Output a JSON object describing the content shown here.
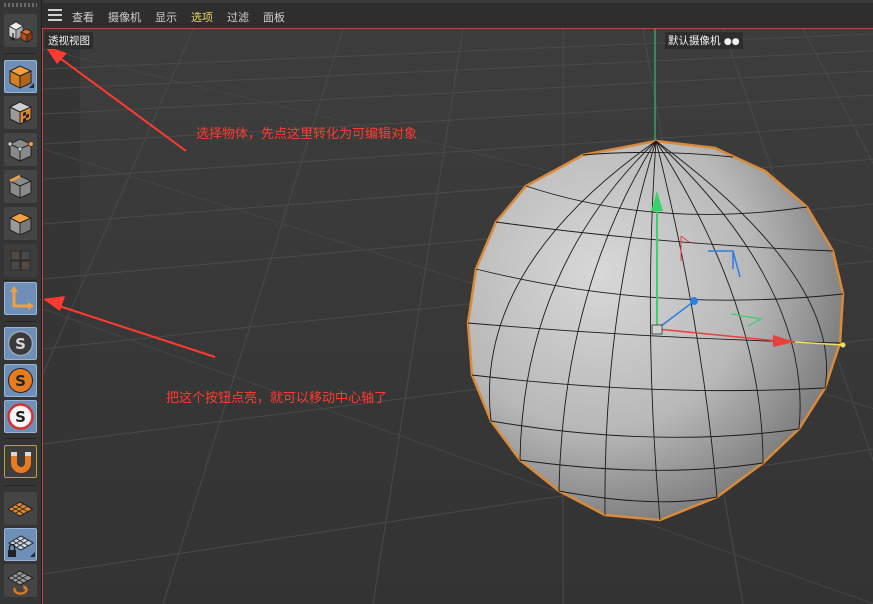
{
  "menubar": {
    "items": [
      {
        "label": "查看"
      },
      {
        "label": "摄像机"
      },
      {
        "label": "显示"
      },
      {
        "label": "选项"
      },
      {
        "label": "过滤"
      },
      {
        "label": "面板"
      }
    ]
  },
  "viewport": {
    "view_label": "透视视图",
    "camera_label": "默认摄像机"
  },
  "toolbar": {
    "buttons": [
      {
        "name": "make-editable",
        "icon": "make-editable-icon",
        "active": false
      },
      {
        "name": "model-mode",
        "icon": "model-mode-icon",
        "active": true
      },
      {
        "name": "texture-mode",
        "icon": "texture-mode-icon",
        "active": false
      },
      {
        "name": "points-mode",
        "icon": "points-mode-icon",
        "active": false
      },
      {
        "name": "edges-mode",
        "icon": "edges-mode-icon",
        "active": false
      },
      {
        "name": "polygons-mode",
        "icon": "polygons-mode-icon",
        "active": false
      },
      {
        "name": "uv-mode",
        "icon": "uv-mode-icon",
        "active": false
      },
      {
        "name": "enable-axis",
        "icon": "axis-icon",
        "active": true
      },
      {
        "name": "snap-settings",
        "icon": "snap-icon",
        "active": false
      },
      {
        "name": "snap-enable",
        "icon": "snap-orange-icon",
        "active": false
      },
      {
        "name": "snap-off",
        "icon": "snap-off-icon",
        "active": false
      },
      {
        "name": "magnet",
        "icon": "magnet-icon",
        "active": false
      },
      {
        "name": "workplane",
        "icon": "workplane-icon",
        "active": false
      },
      {
        "name": "lock-workplane",
        "icon": "lock-workplane-icon",
        "active": false
      },
      {
        "name": "align-workplane",
        "icon": "align-workplane-icon",
        "active": false
      }
    ]
  },
  "annotations": {
    "top": "选择物体，先点这里转化为可编辑对象",
    "bottom": "把这个按钮点亮，就可以移动中心轴了"
  },
  "colors": {
    "annotation": "#ff3b30",
    "accent_active": "#6e8fb7",
    "selection_outline": "#d98a3a",
    "axis_x": "#e8403c",
    "axis_y": "#3ad16b",
    "axis_z": "#2f7de0"
  }
}
